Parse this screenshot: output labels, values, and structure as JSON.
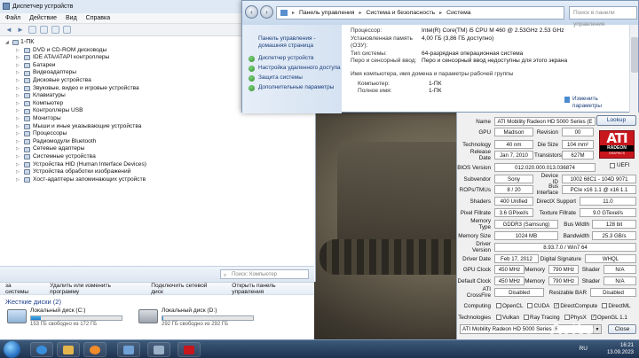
{
  "device_manager": {
    "title": "Диспетчер устройств",
    "menu": [
      "Файл",
      "Действие",
      "Вид",
      "Справка"
    ],
    "root": "1-ПК",
    "items": [
      "DVD и CD-ROM дисководы",
      "IDE ATA/ATAPI контроллеры",
      "Батареи",
      "Видеоадаптеры",
      "Дисковые устройства",
      "Звуковые, видео и игровые устройства",
      "Клавиатуры",
      "Компьютер",
      "Контроллеры USB",
      "Мониторы",
      "Мыши и иные указывающие устройства",
      "Процессоры",
      "Радиомодули Bluetooth",
      "Сетевые адаптеры",
      "Системные устройства",
      "Устройства HID (Human Interface Devices)",
      "Устройства обработки изображений",
      "Хост-адаптеры запоминающих устройств"
    ]
  },
  "explorer": {
    "search_placeholder": "Поиск: Компьютер",
    "toolbar": [
      "за системы",
      "Удалить или изменить программу",
      "Подключить сетевой диск",
      "Открыть панель управления"
    ],
    "section_title": "Жесткие диски (2)",
    "drives": [
      {
        "name": "Локальный диск (C:)",
        "free": "153 ГБ свободно из 172 ГБ",
        "used_fraction": 0.11
      },
      {
        "name": "Локальный диск (D:)",
        "free": "292 ГБ свободно из 292 ГБ",
        "used_fraction": 0.01
      }
    ]
  },
  "control_panel": {
    "breadcrumb": [
      "Панель управления",
      "Система и безопасность",
      "Система"
    ],
    "search_placeholder": "Поиск в панели управления",
    "home": "Панель управления - домашняя страница",
    "links": [
      "Диспетчер устройств",
      "Настройка удаленного доступа",
      "Защита системы",
      "Дополнительные параметры"
    ],
    "rows": [
      {
        "k": "Процессор:",
        "v": "Intel(R) Core(TM) i5 CPU      M 460 @ 2.53GHz   2.53 GHz"
      },
      {
        "k": "Установленная память (ОЗУ):",
        "v": "4,00 ГБ (3,86 ГБ доступно)"
      },
      {
        "k": "Тип системы:",
        "v": "64-разрядная операционная система"
      },
      {
        "k": "Перо и сенсорный ввод:",
        "v": "Перо и сенсорный ввод недоступны для этого экрана"
      }
    ],
    "section": "Имя компьютера, имя домена и параметры рабочей группы",
    "rows2": [
      {
        "k": "Компьютер:",
        "v": "1-ПК"
      },
      {
        "k": "Полное имя:",
        "v": "1-ПК"
      }
    ],
    "change": "Изменить параметры"
  },
  "gpuz": {
    "lookup": "Lookup",
    "name": "ATI Mobility Radeon HD 5000 Series (E",
    "gpu": "Madison",
    "revision": "00",
    "technology": "40 nm",
    "die_size": "104 mm²",
    "release_date": "Jan 7, 2010",
    "transistors": "627M",
    "bios": "012.020.000.013.036874",
    "uefi": "UEFI",
    "subvendor": "Sony",
    "device_id": "1002 68C1 - 104D 9071",
    "rops_tmus": "8 / 20",
    "bus_interface": "PCIe x16 1.1 @ x16 1.1",
    "shaders": "400 Unified",
    "directx": "11.0",
    "pixel_fillrate": "3.6 GPixel/s",
    "texture_fillrate": "9.0 GTexel/s",
    "memory_type": "GDDR3 (Samsung)",
    "bus_width": "128 bit",
    "memory_size": "1024 MB",
    "bandwidth": "25.3 GB/s",
    "driver_version": "8.93.7.0 / Win7 64",
    "driver_date": "Feb 17, 2012",
    "digital_signature": "WHQL",
    "gpu_clock": "450 MHz",
    "memory_clock": "790 MHz",
    "shader_clock": "N/A",
    "default_clock": "450 MHz",
    "default_memory": "790 MHz",
    "default_shader": "N/A",
    "crossfire": "Disabled",
    "resizable_bar": "Disabled",
    "labels": {
      "name": "Name",
      "gpu": "GPU",
      "revision": "Revision",
      "technology": "Technology",
      "die_size": "Die Size",
      "release_date": "Release Date",
      "transistors": "Transistors",
      "bios": "BIOS Version",
      "subvendor": "Subvendor",
      "device_id": "Device ID",
      "rops": "ROPs/TMUs",
      "bus_interface": "Bus Interface",
      "shaders": "Shaders",
      "directx": "DirectX Support",
      "pixel": "Pixel Fillrate",
      "texture": "Texture Fillrate",
      "memtype": "Memory Type",
      "buswidth": "Bus Width",
      "memsize": "Memory Size",
      "bandwidth": "Bandwidth",
      "driver_version": "Driver Version",
      "driver_date": "Driver Date",
      "digsig": "Digital Signature",
      "gpu_clock": "GPU Clock",
      "memory": "Memory",
      "shader": "Shader",
      "default_clock": "Default Clock",
      "crossfire": "ATI CrossFire",
      "resizable_bar": "Resizable BAR",
      "computing": "Computing",
      "technologies": "Technologies"
    },
    "computing": [
      {
        "label": "OpenCL",
        "checked": false
      },
      {
        "label": "CUDA",
        "checked": false
      },
      {
        "label": "DirectCompute",
        "checked": true
      },
      {
        "label": "DirectML",
        "checked": false
      }
    ],
    "technologies": [
      {
        "label": "Vulkan",
        "checked": false
      },
      {
        "label": "Ray Tracing",
        "checked": false
      },
      {
        "label": "PhysX",
        "checked": false
      },
      {
        "label": "OpenGL 1.1",
        "checked": true
      }
    ],
    "logo": {
      "ati": "ATI",
      "radeon": "RADEON",
      "graphics": "GRAPHICS"
    },
    "selected_gpu": "ATI Mobility Radeon HD 5000 Series (E",
    "close": "Close"
  },
  "taskbar": {
    "lang": "RU",
    "time": "16:21",
    "date": "13.09.2023"
  },
  "watermark": "Avito",
  "colors": {
    "ati_red": "#c8161d",
    "link_blue": "#1a3d7a",
    "drive_bar": "#1e7cc8"
  }
}
